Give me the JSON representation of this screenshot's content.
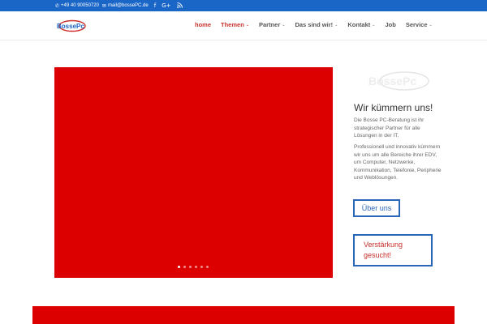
{
  "topbar": {
    "phone": "+49 40 90050720",
    "email": "mail@bossePC.de",
    "social": [
      "f",
      "G+",
      "rss"
    ]
  },
  "header": {
    "logo_text": "BossePc",
    "nav": [
      {
        "label": "home",
        "active": true,
        "has_dropdown": false
      },
      {
        "label": "Themen",
        "active": true,
        "has_dropdown": true
      },
      {
        "label": "Partner",
        "active": false,
        "has_dropdown": true
      },
      {
        "label": "Das sind wir!",
        "active": false,
        "has_dropdown": true
      },
      {
        "label": "Kontakt",
        "active": false,
        "has_dropdown": true
      },
      {
        "label": "Job",
        "active": false,
        "has_dropdown": false
      },
      {
        "label": "Service",
        "active": false,
        "has_dropdown": true
      }
    ]
  },
  "slider": {
    "color": "#dd0000",
    "slide_count": 6,
    "active_slide": 1
  },
  "sidebar": {
    "heading": "Wir kümmern uns!",
    "paragraph1": "Die Bosse PC-Beratung ist ihr strategischer Partner für alle Lösungen in der IT.",
    "paragraph2": "Professionell und innovativ kümmern wir uns um alle Bereiche ihrer EDV, um Computer, Netzwerke, Kommunikation, Telefonie, Peripherie und Weblösungen.",
    "button1": "Über uns",
    "button2_line1": "Verstärkung",
    "button2_line2": "gesucht!"
  },
  "colors": {
    "topbar_blue": "#1a66c7",
    "accent_red": "#c9302c",
    "slider_red": "#dd0000",
    "button_border_blue": "#2a66b8"
  }
}
